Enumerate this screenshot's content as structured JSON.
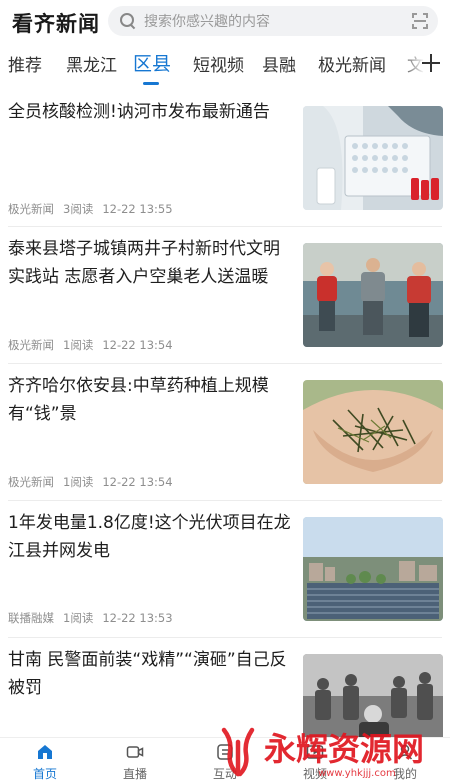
{
  "header": {
    "logo": "看齐新闻",
    "search_placeholder": "搜索你感兴趣的内容"
  },
  "tabs": [
    {
      "label": "推荐"
    },
    {
      "label": "黑龙江"
    },
    {
      "label": "区县",
      "active": true
    },
    {
      "label": "短视频"
    },
    {
      "label": "县融"
    },
    {
      "label": "极光新闻"
    },
    {
      "label": "文"
    }
  ],
  "feed": [
    {
      "title": "全员核酸检测!讷河市发布最新通告",
      "source": "极光新闻",
      "reads": "3阅读",
      "time": "12-22 13:55",
      "image": "lab-test-photo"
    },
    {
      "title": "泰来县塔子城镇两井子村新时代文明实践站 志愿者入户空巢老人送温暖",
      "source": "极光新闻",
      "reads": "1阅读",
      "time": "12-22 13:54",
      "image": "volunteers-photo"
    },
    {
      "title": "齐齐哈尔依安县:中草药种植上规模有“钱”景",
      "source": "极光新闻",
      "reads": "1阅读",
      "time": "12-22 13:54",
      "image": "herbs-in-hands-photo"
    },
    {
      "title": "1年发电量1.8亿度!这个光伏项目在龙江县并网发电",
      "source": "联播融媒",
      "reads": "1阅读",
      "time": "12-22 13:53",
      "image": "solar-field-photo"
    },
    {
      "title": "甘南 民警面前装“戏精”“演砸”自己反被罚",
      "source": "",
      "reads": "",
      "time": "",
      "image": "police-station-photo"
    }
  ],
  "bottom_nav": [
    {
      "label": "首页",
      "icon": "home-icon",
      "active": true
    },
    {
      "label": "直播",
      "icon": "video-camera-icon"
    },
    {
      "label": "互动",
      "icon": "interaction-icon"
    },
    {
      "label": "视频",
      "icon": "video-icon"
    },
    {
      "label": "我的",
      "icon": "user-icon"
    }
  ],
  "watermark": {
    "text": "永辉资源网",
    "url": "www.yhkjjj.com"
  },
  "colors": {
    "accent": "#1677d2",
    "watermark_red": "#e0161f"
  }
}
